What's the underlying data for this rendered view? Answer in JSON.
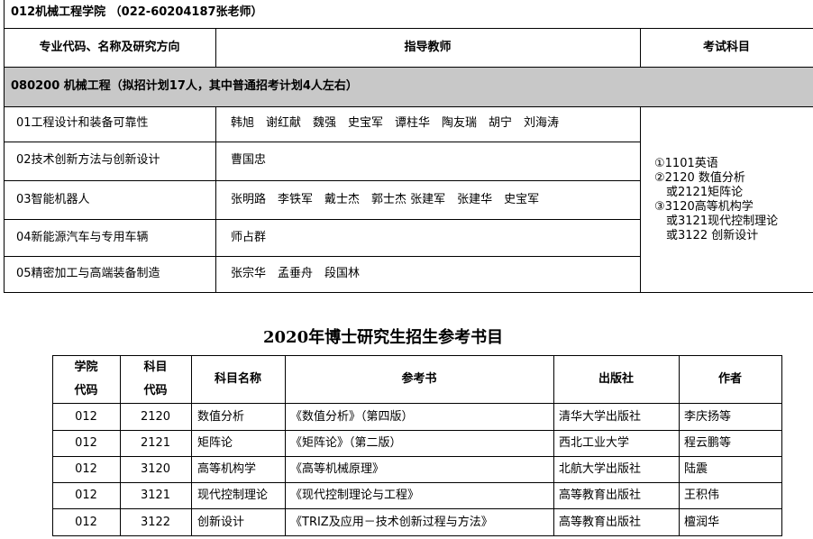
{
  "header": {
    "school": "012机械工程学院 （022-60204187张老师）"
  },
  "table1": {
    "headers": [
      "专业代码、名称及研究方向",
      "指导教师",
      "考试科目"
    ],
    "major": "080200 机械工程（拟招计划17人，其中普通招考计划4人左右）",
    "rows": [
      {
        "direction": "01工程设计和装备可靠性",
        "teachers": "韩旭　谢红献　魏强　史宝军　谭柱华　陶友瑞　胡宁　刘海涛"
      },
      {
        "direction": "02技术创新方法与创新设计",
        "teachers": "曹国忠"
      },
      {
        "direction": "03智能机器人",
        "teachers": "张明路　李铁军　戴士杰　郭士杰 张建军　张建华　史宝军"
      },
      {
        "direction": "04新能源汽车与专用车辆",
        "teachers": "师占群"
      },
      {
        "direction": "05精密加工与高端装备制造",
        "teachers": "张宗华　孟垂舟　段国林"
      }
    ],
    "exam": [
      "①1101英语",
      "②2120 数值分析",
      "　或2121矩阵论",
      "③3120高等机构学",
      "　或3121现代控制理论",
      "　或3122 创新设计"
    ]
  },
  "section_title": "2020年博士研究生招生参考书目",
  "table2": {
    "headers": {
      "college": [
        "学院",
        "代码"
      ],
      "subject": [
        "科目",
        "代码"
      ],
      "name": "科目名称",
      "book": "参考书",
      "publisher": "出版社",
      "author": "作者"
    },
    "rows": [
      {
        "college": "012",
        "code": "2120",
        "name": "数值分析",
        "book": "《数值分析》（第四版）",
        "publisher": "清华大学出版社",
        "author": "李庆扬等"
      },
      {
        "college": "012",
        "code": "2121",
        "name": "矩阵论",
        "book": "《矩阵论》（第二版）",
        "publisher": "西北工业大学",
        "author": "程云鹏等"
      },
      {
        "college": "012",
        "code": "3120",
        "name": "高等机构学",
        "book": "《高等机械原理》",
        "publisher": "北航大学出版社",
        "author": "陆震"
      },
      {
        "college": "012",
        "code": "3121",
        "name": "现代控制理论",
        "book": "《现代控制理论与工程》",
        "publisher": "高等教育出版社",
        "author": "王积伟"
      },
      {
        "college": "012",
        "code": "3122",
        "name": "创新设计",
        "book": "《TRIZ及应用－技术创新过程与方法》",
        "publisher": "高等教育出版社",
        "author": "檀润华"
      }
    ]
  }
}
